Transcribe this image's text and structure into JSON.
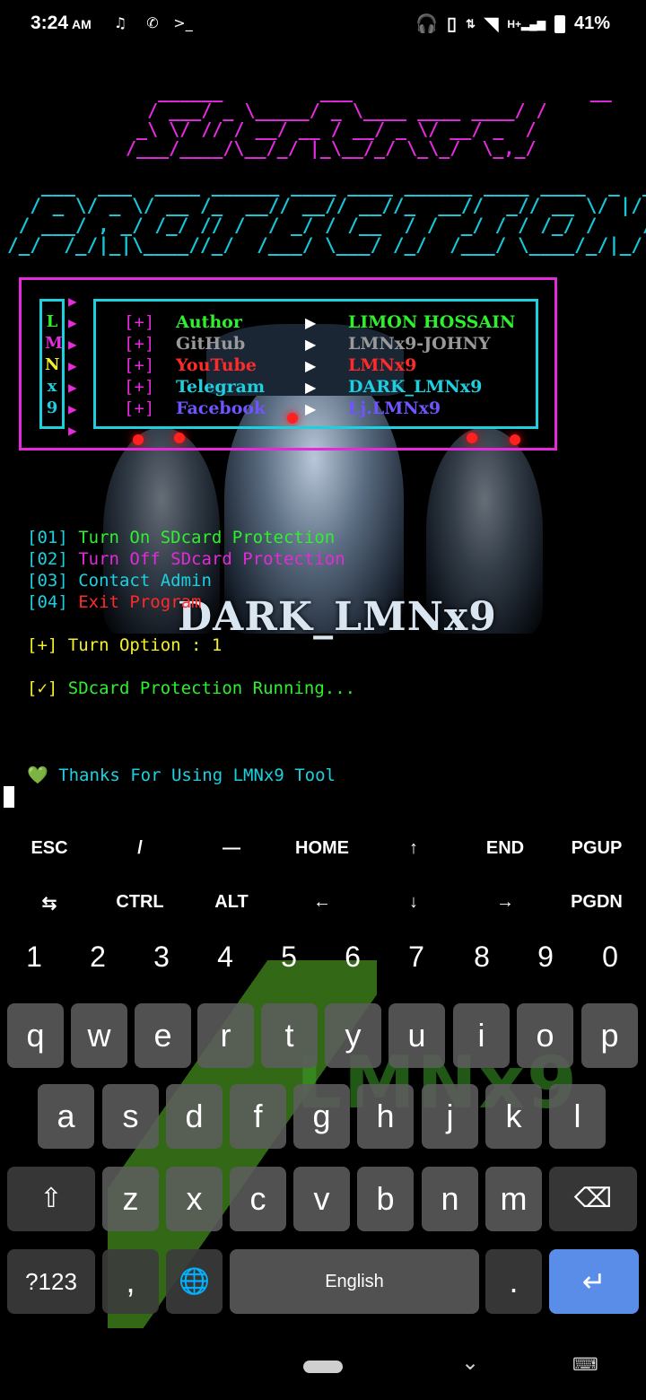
{
  "status_bar": {
    "time": "3:24",
    "ampm": "AM",
    "battery": "41%",
    "left_icons": [
      "music-icon",
      "whatsapp-icon",
      "terminal-icon"
    ],
    "right_icons": [
      "headphones-icon",
      "vibrate-icon",
      "data-arrows-icon",
      "wifi-icon",
      "signal-icon",
      "battery-icon"
    ]
  },
  "terminal": {
    "banner_sdcard": "   ______         ___                      __\n  / ___/ _ \\_____/ _ \\____ ____ ____/ /\n _\\ \\/ // / __/ __ / __/ _ \\/ __/ _  / \n/___/____/\\__/_/ |_\\__/_/ \\_\\_/  \\_,_/  ",
    "banner_protection": "   ___  ___  ____ ______ ____ ____ ______ ____ ____  _  __\n  / _ \\/ _ \\/ __ /_  __// __// __//_  __//  _// __ \\/ |/ /\n / ___/ , _/ /_/ // /  / _/ / /__  / /  _/ / / /_/ /    / \n/_/  /_/|_|\\____//_/  /___/ \\___/ /_/  /___/ \\____/_/|_/  ",
    "lmnx_letters": [
      "L",
      "M",
      "N",
      "x",
      "9"
    ],
    "lmnx_colors": [
      "#2ef02e",
      "#e42ad9",
      "#f3f02b",
      "#1cd0df",
      "#1cd0df"
    ],
    "info": [
      {
        "plus": "[+]",
        "label": "Author",
        "value": "LIMON HOSSAIN",
        "color": "#2ef02e"
      },
      {
        "plus": "[+]",
        "label": "GitHub",
        "value": "LMNx9-JOHNY",
        "color": "#9a9a9a"
      },
      {
        "plus": "[+]",
        "label": "YouTube",
        "value": "LMNx9",
        "color": "#ff2a2a"
      },
      {
        "plus": "[+]",
        "label": "Telegram",
        "value": "DARK_LMNx9",
        "color": "#1cd0df"
      },
      {
        "plus": "[+]",
        "label": "Facebook",
        "value": "Lj.LMNx9",
        "color": "#6f55ff"
      }
    ],
    "menu": [
      {
        "num": "[01]",
        "text": "Turn On SDcard Protection",
        "color": "#2ef02e"
      },
      {
        "num": "[02]",
        "text": "Turn Off SDcard Protection",
        "color": "#e42ad9"
      },
      {
        "num": "[03]",
        "text": "Contact Admin",
        "color": "#1cd0df"
      },
      {
        "num": "[04]",
        "text": "Exit Program",
        "color": "#ff2a2a"
      }
    ],
    "background_text": "DARK_LMNx9",
    "prompt": "[+] Turn Option : 1",
    "status_line_mark": "[✓]",
    "status_line_text": "SDcard Protection Running...",
    "thanks_icon": "💚",
    "thanks_text": "Thanks For Using LMNx9 Tool"
  },
  "extra_keys": {
    "row1": [
      "ESC",
      "/",
      "—",
      "HOME",
      "↑",
      "END",
      "PGUP"
    ],
    "row2": [
      "⇆",
      "CTRL",
      "ALT",
      "←",
      "↓",
      "→",
      "PGDN"
    ]
  },
  "keyboard": {
    "numbers": [
      "1",
      "2",
      "3",
      "4",
      "5",
      "6",
      "7",
      "8",
      "9",
      "0"
    ],
    "row1": [
      "q",
      "w",
      "e",
      "r",
      "t",
      "y",
      "u",
      "i",
      "o",
      "p"
    ],
    "row2": [
      "a",
      "s",
      "d",
      "f",
      "g",
      "h",
      "j",
      "k",
      "l"
    ],
    "row3": [
      "z",
      "x",
      "c",
      "v",
      "b",
      "n",
      "m"
    ],
    "symbols_key": "?123",
    "comma": ",",
    "space_label": "English",
    "period": ".",
    "shift_icon": "⇧",
    "backspace_icon": "⌫",
    "globe_icon": "🌐",
    "enter_icon": "↵",
    "theme_text": "LMNx9"
  },
  "nav": {
    "back_icon": "⌄",
    "keyboard_icon": "⌨"
  }
}
